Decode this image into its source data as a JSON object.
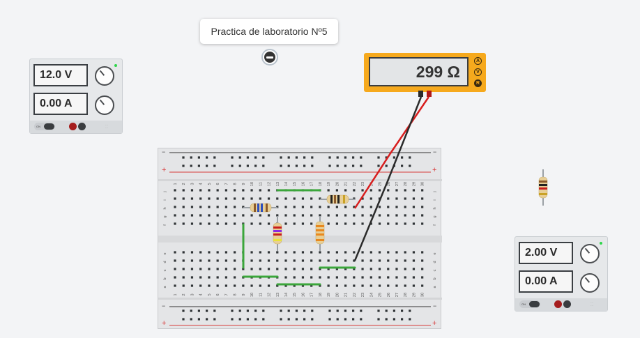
{
  "note": {
    "text": "Practica de laboratorio Nº5"
  },
  "psu_left": {
    "voltage": "12.0 V",
    "current": "0.00 A",
    "switch_label": "ON"
  },
  "psu_right": {
    "voltage": "2.00 V",
    "current": "0.00 A",
    "switch_label": "ON"
  },
  "multimeter": {
    "reading": "299 Ω",
    "modes": [
      "A",
      "V",
      "R"
    ],
    "active_mode": "R"
  },
  "breadboard": {
    "columns": [
      "1",
      "2",
      "3",
      "4",
      "5",
      "6",
      "7",
      "8",
      "9",
      "10",
      "11",
      "12",
      "13",
      "14",
      "15",
      "16",
      "17",
      "18",
      "19",
      "20",
      "21",
      "22",
      "23",
      "24",
      "25",
      "26",
      "27",
      "28",
      "29",
      "30"
    ],
    "rows_top": [
      "j",
      "i",
      "h",
      "g",
      "f"
    ],
    "rows_bottom": [
      "e",
      "d",
      "c",
      "b",
      "a"
    ],
    "rail_minus": "−",
    "rail_plus": "+"
  },
  "colors": {
    "meter_body": "#f6a91d",
    "probe_red": "#d81e1e",
    "probe_black": "#2b2b2b",
    "jumper_green": "#3ba63b",
    "rail_red": "#d83a3a"
  }
}
